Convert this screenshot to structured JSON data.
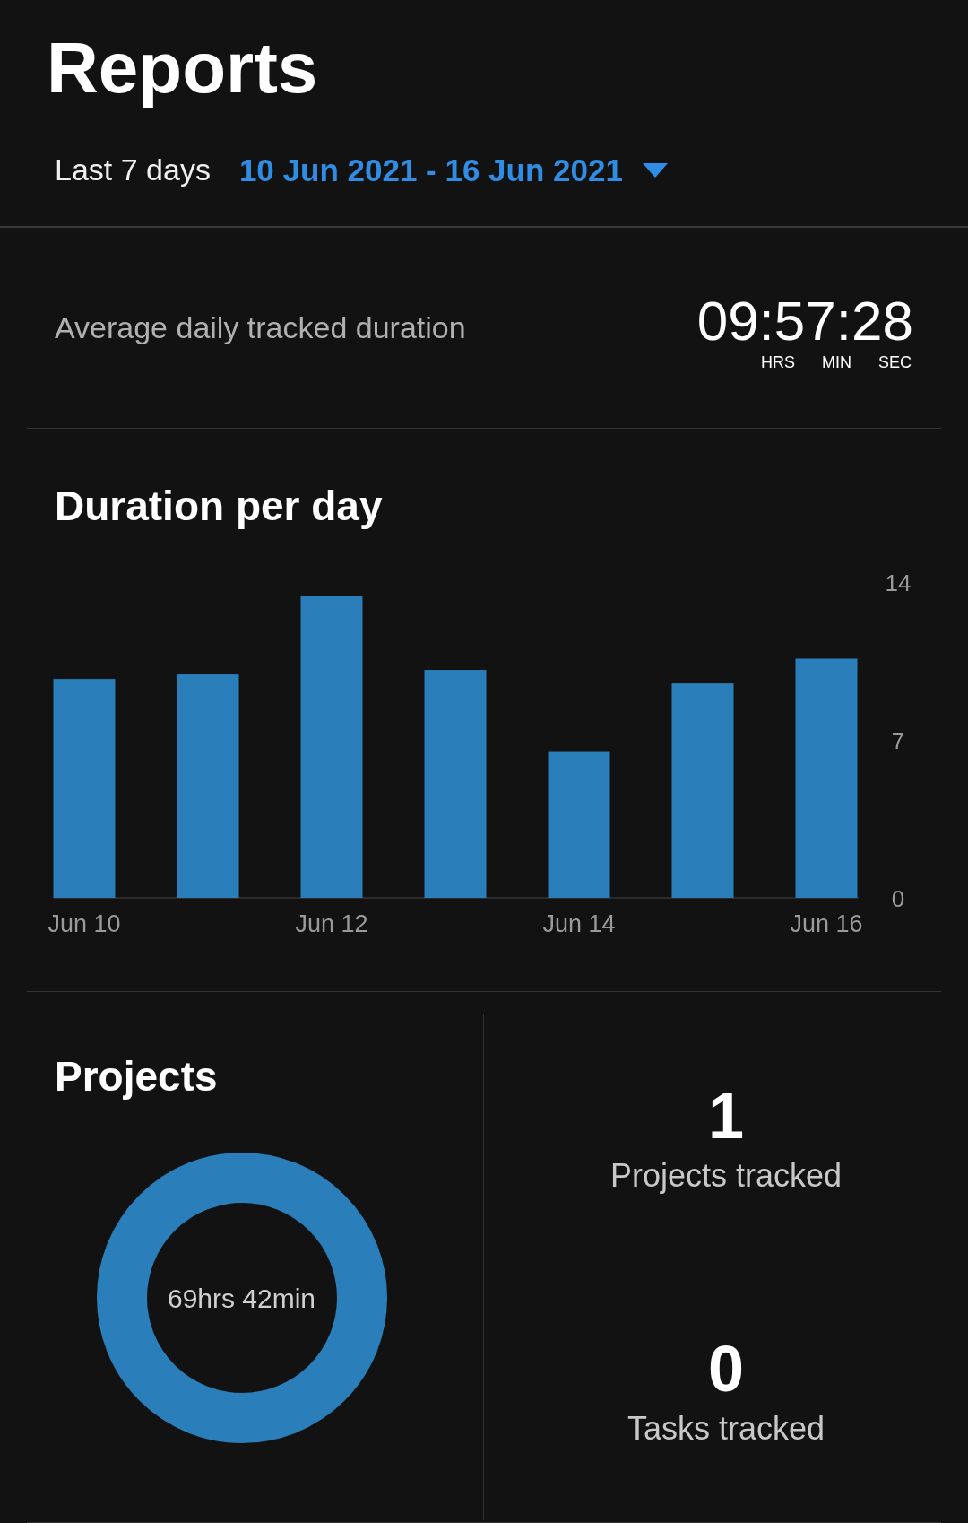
{
  "header": {
    "title": "Reports"
  },
  "filter": {
    "period": "Last 7 days",
    "range": "10 Jun 2021 - 16 Jun 2021"
  },
  "average": {
    "label": "Average daily tracked duration",
    "time": "09:57:28",
    "units": [
      "HRS",
      "MIN",
      "SEC"
    ]
  },
  "duration_chart": {
    "title": "Duration per day",
    "chart_data": {
      "type": "bar",
      "categories": [
        "Jun 10",
        null,
        "Jun 12",
        null,
        "Jun 14",
        null,
        "Jun 16"
      ],
      "values": [
        9.7,
        9.9,
        13.4,
        10.1,
        6.5,
        9.5,
        10.6
      ],
      "ylim": [
        0,
        14
      ],
      "yticks": [
        0,
        7,
        14
      ]
    }
  },
  "projects": {
    "title": "Projects",
    "total": "69hrs 42min"
  },
  "stats": [
    {
      "value": "1",
      "label": "Projects tracked"
    },
    {
      "value": "0",
      "label": "Tasks tracked"
    }
  ]
}
